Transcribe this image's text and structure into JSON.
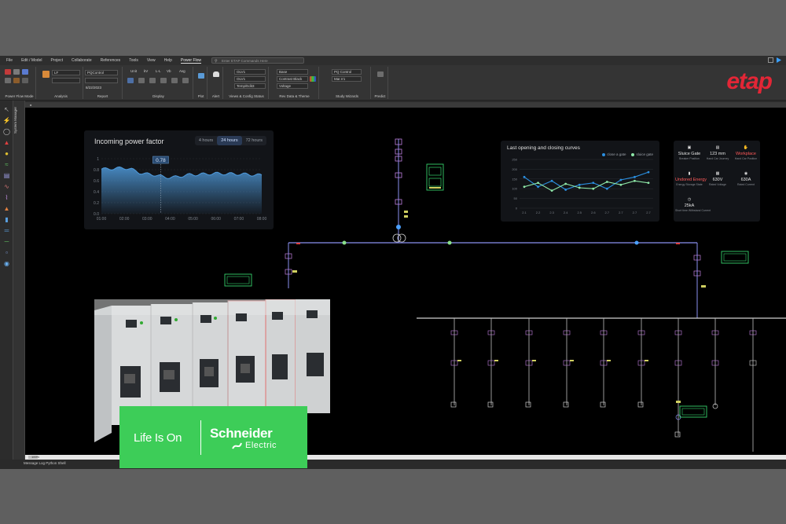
{
  "menu": {
    "items": [
      "File",
      "Edit / Model",
      "Project",
      "Collaborate",
      "References",
      "Tools",
      "View",
      "Help"
    ],
    "active": "Power Flow",
    "search_placeholder": "Enter ETAP Commands Here"
  },
  "ribbon": {
    "groups": [
      "Power Flow Mode",
      "Analysis",
      "Report",
      "Display",
      "Plot",
      "Alert",
      "Views & Config Status",
      "Rev Data & Theme",
      "Study Wizards",
      "Predict"
    ],
    "analysis": {
      "study_case": "LF"
    },
    "report": {
      "report_name": "PQControl",
      "date": "8/22/2023"
    },
    "display": {
      "labels": [
        "Unit",
        "kV",
        "L-L",
        "Vb",
        "Avg"
      ]
    },
    "views": {
      "dropdowns": [
        "OLV1",
        "OLV1",
        "Temp/Edit3"
      ]
    },
    "theme": {
      "dropdowns": [
        "Base",
        "Contrast Black",
        "Voltage"
      ]
    },
    "wizards": {
      "dropdowns": [
        "PQ Control",
        "Mar.rr1"
      ]
    },
    "brand": "etap"
  },
  "sidebar": {
    "label": "System Manager"
  },
  "statusbar": {
    "text": "Message Log  Python Shell"
  },
  "scrollbar_label": "100%",
  "pf_panel": {
    "title": "Incoming power factor",
    "tabs": [
      "4 hours",
      "24 hours",
      "72 hours"
    ],
    "selected_tab": "24 hours",
    "marker_value": "0.78"
  },
  "chart_data": [
    {
      "type": "area",
      "title": "Incoming power factor",
      "x": [
        "01:00",
        "02:00",
        "03:00",
        "04:00",
        "05:00",
        "06:00",
        "07:00",
        "08:00"
      ],
      "values": [
        0.81,
        0.83,
        0.72,
        0.66,
        0.71,
        0.73,
        0.72,
        0.7
      ],
      "y_ticks": [
        "1",
        "0.8",
        "0.6",
        "0.4",
        "0.2",
        "0.0"
      ],
      "ylim": [
        0,
        1
      ],
      "color": "#4f9bdc"
    },
    {
      "type": "line",
      "title": "Last opening and closing curves",
      "categories": [
        "2.1",
        "2.2",
        "2.3",
        "2.4",
        "2.5",
        "2.6",
        "2.7",
        "2.7",
        "2.7",
        "2.7"
      ],
      "y_ticks": [
        "250",
        "200",
        "150",
        "100",
        "50",
        "0"
      ],
      "ylim": [
        0,
        250
      ],
      "series": [
        {
          "name": "close a gate",
          "color": "#2b8fe0",
          "values": [
            160,
            110,
            140,
            95,
            120,
            130,
            100,
            145,
            160,
            185
          ]
        },
        {
          "name": "sluice gate",
          "color": "#8ee7a8",
          "values": [
            110,
            130,
            90,
            125,
            105,
            100,
            135,
            120,
            140,
            130
          ]
        }
      ]
    }
  ],
  "info_panel": [
    {
      "icon": "cabinet-icon",
      "value": "Sluice Gate",
      "sub": "Breaker Position",
      "red": false
    },
    {
      "icon": "ruler-icon",
      "value": "123 mm",
      "sub": "Hand Car Journey",
      "red": false
    },
    {
      "icon": "hand-icon",
      "value": "Workplace",
      "sub": "Hand Car Position",
      "red": true
    },
    {
      "icon": "battery-icon",
      "value": "Undored Energy",
      "sub": "Energy Storage State",
      "red": true
    },
    {
      "icon": "voltage-icon",
      "value": "630V",
      "sub": "Rated Voltage",
      "red": false
    },
    {
      "icon": "current-icon",
      "value": "630A",
      "sub": "Rated Current",
      "red": false
    },
    {
      "icon": "clock-icon",
      "value": "25kA",
      "sub": "Short time Withstand Current",
      "red": false
    }
  ],
  "schneider": {
    "tagline": "Life Is On",
    "name": "Schneider",
    "sub": "Electric"
  }
}
